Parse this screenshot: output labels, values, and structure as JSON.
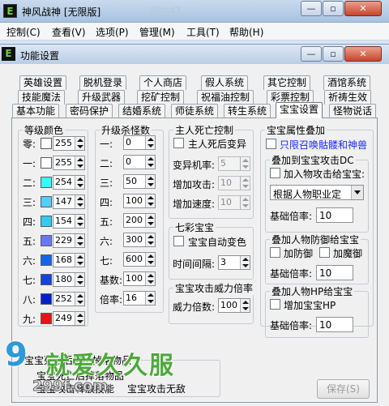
{
  "app": {
    "title": "神风战神 [无限版]",
    "ghost_title": "Hfmd3",
    "controls": [
      "—",
      "▫",
      "✕"
    ]
  },
  "menu": [
    "控制(C)",
    "查看(V)",
    "选项(P)",
    "管理(M)",
    "工具(T)",
    "帮助(H)"
  ],
  "dialog": {
    "title": "功能设置",
    "controls": [
      "—",
      "▫",
      "✕"
    ]
  },
  "tabs_row1": [
    "英雄设置",
    "脱机登录",
    "个人商店",
    "假人系统",
    "其它控制",
    "酒馆系统"
  ],
  "tabs_row2": [
    "技能魔法",
    "升级武器",
    "挖矿控制",
    "祝福油控制",
    "彩票控制",
    "祈祷生效"
  ],
  "tabs_row3": [
    "基本功能",
    "密码保护",
    "结婚系统",
    "师徒系统",
    "转生系统",
    "宝宝设置",
    "怪物说话"
  ],
  "level_color": {
    "title": "等级颜色",
    "rows": [
      {
        "label": "零:",
        "value": "255",
        "color": "#ffffff"
      },
      {
        "label": "一:",
        "value": "255",
        "color": "#ffffff"
      },
      {
        "label": "二:",
        "value": "254",
        "color": "#33ffff"
      },
      {
        "label": "三:",
        "value": "147",
        "color": "#55ccff"
      },
      {
        "label": "四:",
        "value": "154",
        "color": "#33ccee"
      },
      {
        "label": "五:",
        "value": "229",
        "color": "#6677ff"
      },
      {
        "label": "六:",
        "value": "168",
        "color": "#1166ee"
      },
      {
        "label": "七:",
        "value": "180",
        "color": "#1144dd"
      },
      {
        "label": "八:",
        "value": "252",
        "color": "#0022cc"
      },
      {
        "label": "九:",
        "value": "249",
        "color": "#ee1111"
      }
    ]
  },
  "level_kills": {
    "title": "升级杀怪数",
    "rows": [
      {
        "label": "一:",
        "value": "0"
      },
      {
        "label": "二:",
        "value": "0"
      },
      {
        "label": "三:",
        "value": "50"
      },
      {
        "label": "四:",
        "value": "100"
      },
      {
        "label": "五:",
        "value": "200"
      },
      {
        "label": "六:",
        "value": "300"
      },
      {
        "label": "七:",
        "value": "600"
      },
      {
        "label": "基数:",
        "value": "100"
      },
      {
        "label": "倍率:",
        "value": "16"
      }
    ]
  },
  "master_death": {
    "title": "主人死亡控制",
    "checkbox": "主人死后变异",
    "rows": [
      {
        "label": "变异机率:",
        "value": "5"
      },
      {
        "label": "增加攻击:",
        "value": "10"
      },
      {
        "label": "增加速度:",
        "value": "10"
      }
    ]
  },
  "rainbow": {
    "title": "七彩宝宝",
    "checkbox": "宝宝自动变色",
    "interval_label": "时间间隔:",
    "interval_value": "3"
  },
  "atk_power": {
    "title": "宝宝攻击威力倍率",
    "label": "威力倍数:",
    "value": "100"
  },
  "pet_attr": {
    "title": "宝宝属性叠加",
    "only_label": "只限召唤骷髅和神兽",
    "dc": {
      "title": "叠加到宝宝攻击DC",
      "checkbox": "加入物攻击给宝宝:",
      "select": "根据人物职业定",
      "rate_label": "基础倍率:",
      "rate_value": "10"
    },
    "def": {
      "title": "叠加人物防御给宝宝",
      "cb1": "加防御",
      "cb2": "加魔御",
      "rate_label": "基础倍率:",
      "rate_value": "10"
    },
    "hp": {
      "title": "叠加人物HP给宝宝",
      "checkbox": "增加宝宝HP",
      "rate_label": "基础倍率:",
      "rate_value": "10"
    }
  },
  "bottom": {
    "group_title": "宝宝死亡后爆出掉落物品",
    "line1": "宝宝死亡后掉落物品",
    "line2": "宝宝攻击释放技能",
    "line3": "宝宝攻击无敌",
    "save": "保存(S)"
  },
  "watermark": {
    "mark": "9",
    "text": "就爱久久服",
    "url": "299f.com"
  }
}
